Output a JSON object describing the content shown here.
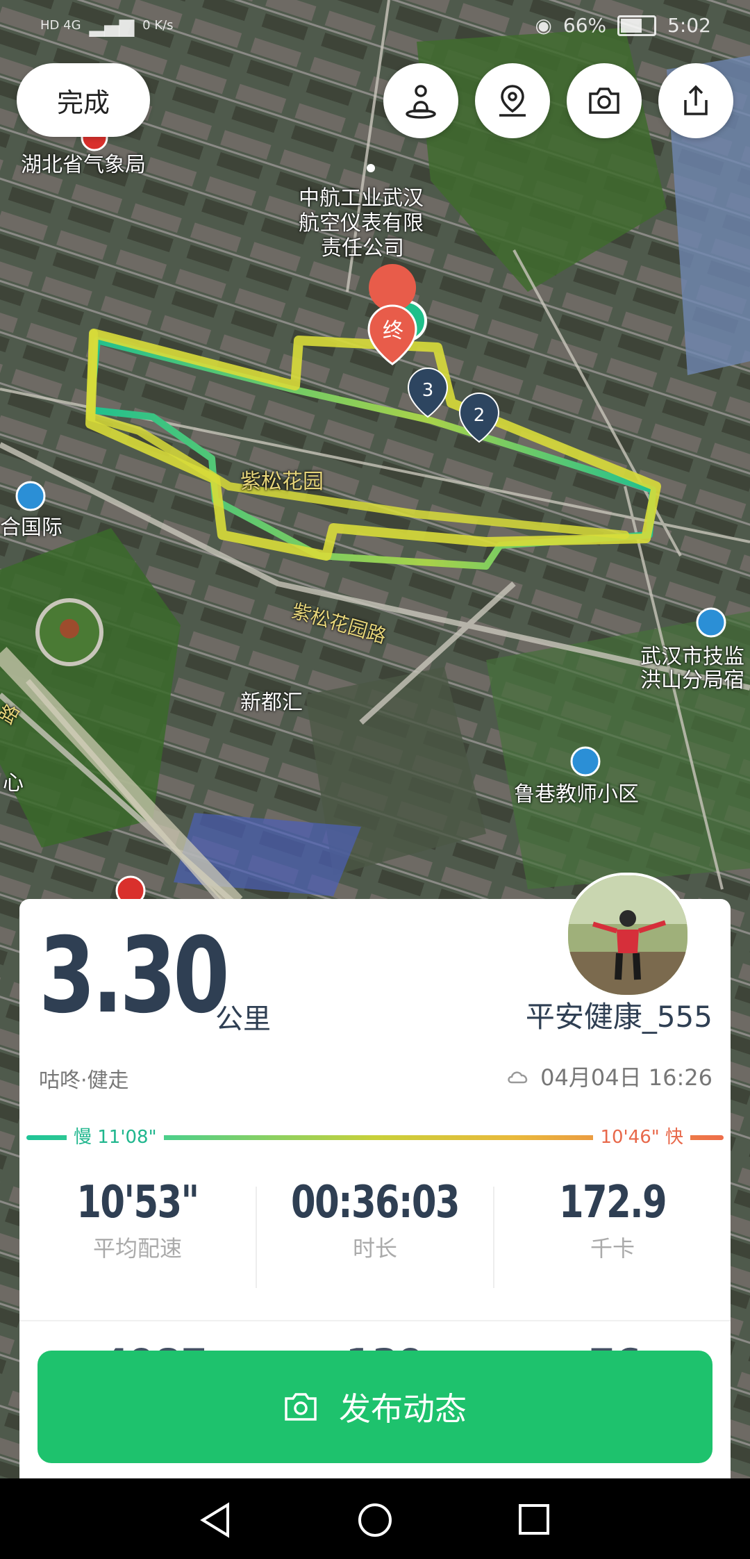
{
  "status_bar": {
    "network": "HD 4G",
    "speed": "0 K/s",
    "battery": "66%",
    "time": "5:02"
  },
  "toolbar": {
    "done_label": "完成"
  },
  "map": {
    "labels": {
      "hubei_weather": "湖北省气象局",
      "avic_1": "中航工业武汉",
      "avic_2": "航空仪表有限",
      "avic_3": "责任公司",
      "zisong_garden": "紫松花园",
      "zisong_road": "紫松花园路",
      "heguoji": "合国际",
      "xinduhui": "新都汇",
      "wuhan_1": "武汉市技监",
      "wuhan_2": "洪山分局宿",
      "luxiang": "鲁巷教师小区",
      "xin": "心",
      "lu": "路"
    },
    "markers": {
      "end": "终",
      "km2": "2",
      "km3": "3"
    }
  },
  "card": {
    "distance": "3.30",
    "unit": "公里",
    "username": "平安健康_555",
    "sport": "咕咚·健走",
    "datetime": "04月04日 16:26",
    "pace_slow": "慢 11'08\"",
    "pace_fast": "10'46\" 快",
    "stats": [
      {
        "value": "10'53\"",
        "label": "平均配速"
      },
      {
        "value": "00:36:03",
        "label": "时长"
      },
      {
        "value": "172.9",
        "label": "千卡"
      }
    ],
    "peek": [
      "4987",
      "139",
      "76"
    ]
  },
  "publish_label": "发布动态"
}
